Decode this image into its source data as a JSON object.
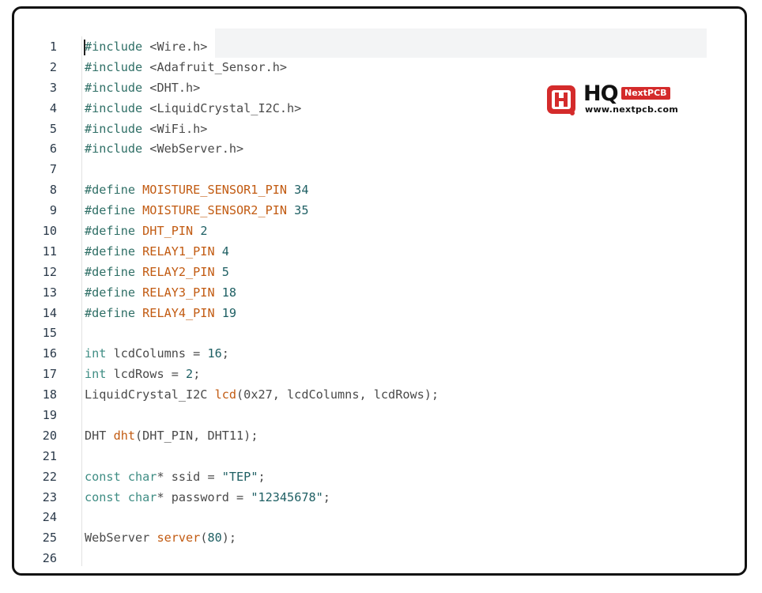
{
  "logo": {
    "brand_letters": "HQ",
    "badge": "NextPCB",
    "url": "www.nextpcb.com",
    "brand_color": "#d42b2b",
    "icon": "hq-logo-icon"
  },
  "editor": {
    "lines": [
      {
        "n": "1",
        "tokens": [
          {
            "t": "#include",
            "c": "kw"
          },
          {
            "t": " <Wire.h>",
            "c": "plain"
          }
        ]
      },
      {
        "n": "2",
        "tokens": [
          {
            "t": "#include",
            "c": "kw"
          },
          {
            "t": " <Adafruit_Sensor.h>",
            "c": "plain"
          }
        ]
      },
      {
        "n": "3",
        "tokens": [
          {
            "t": "#include",
            "c": "kw"
          },
          {
            "t": " <DHT.h>",
            "c": "plain"
          }
        ]
      },
      {
        "n": "4",
        "tokens": [
          {
            "t": "#include",
            "c": "kw"
          },
          {
            "t": " <LiquidCrystal_I2C.h>",
            "c": "plain"
          }
        ]
      },
      {
        "n": "5",
        "tokens": [
          {
            "t": "#include",
            "c": "kw"
          },
          {
            "t": " <WiFi.h>",
            "c": "plain"
          }
        ]
      },
      {
        "n": "6",
        "tokens": [
          {
            "t": "#include",
            "c": "kw"
          },
          {
            "t": " <WebServer.h>",
            "c": "plain"
          }
        ]
      },
      {
        "n": "7",
        "tokens": []
      },
      {
        "n": "8",
        "tokens": [
          {
            "t": "#define ",
            "c": "kw"
          },
          {
            "t": "MOISTURE_SENSOR1_PIN",
            "c": "mac"
          },
          {
            "t": " 34",
            "c": "num"
          }
        ]
      },
      {
        "n": "9",
        "tokens": [
          {
            "t": "#define ",
            "c": "kw"
          },
          {
            "t": "MOISTURE_SENSOR2_PIN",
            "c": "mac"
          },
          {
            "t": " 35",
            "c": "num"
          }
        ]
      },
      {
        "n": "10",
        "tokens": [
          {
            "t": "#define ",
            "c": "kw"
          },
          {
            "t": "DHT_PIN",
            "c": "mac"
          },
          {
            "t": " 2",
            "c": "num"
          }
        ]
      },
      {
        "n": "11",
        "tokens": [
          {
            "t": "#define ",
            "c": "kw"
          },
          {
            "t": "RELAY1_PIN",
            "c": "mac"
          },
          {
            "t": " 4",
            "c": "num"
          }
        ]
      },
      {
        "n": "12",
        "tokens": [
          {
            "t": "#define ",
            "c": "kw"
          },
          {
            "t": "RELAY2_PIN",
            "c": "mac"
          },
          {
            "t": " 5",
            "c": "num"
          }
        ]
      },
      {
        "n": "13",
        "tokens": [
          {
            "t": "#define ",
            "c": "kw"
          },
          {
            "t": "RELAY3_PIN",
            "c": "mac"
          },
          {
            "t": " 18",
            "c": "num"
          }
        ]
      },
      {
        "n": "14",
        "tokens": [
          {
            "t": "#define ",
            "c": "kw"
          },
          {
            "t": "RELAY4_PIN",
            "c": "mac"
          },
          {
            "t": " 19",
            "c": "num"
          }
        ]
      },
      {
        "n": "15",
        "tokens": []
      },
      {
        "n": "16",
        "tokens": [
          {
            "t": "int",
            "c": "kw2"
          },
          {
            "t": " lcdColumns = ",
            "c": "plain"
          },
          {
            "t": "16",
            "c": "num"
          },
          {
            "t": ";",
            "c": "plain"
          }
        ]
      },
      {
        "n": "17",
        "tokens": [
          {
            "t": "int",
            "c": "kw2"
          },
          {
            "t": " lcdRows = ",
            "c": "plain"
          },
          {
            "t": "2",
            "c": "num"
          },
          {
            "t": ";",
            "c": "plain"
          }
        ]
      },
      {
        "n": "18",
        "tokens": [
          {
            "t": "LiquidCrystal_I2C ",
            "c": "plain"
          },
          {
            "t": "lcd",
            "c": "fn"
          },
          {
            "t": "(0x27, lcdColumns, lcdRows);",
            "c": "plain"
          }
        ]
      },
      {
        "n": "19",
        "tokens": []
      },
      {
        "n": "20",
        "tokens": [
          {
            "t": "DHT ",
            "c": "plain"
          },
          {
            "t": "dht",
            "c": "fn"
          },
          {
            "t": "(DHT_PIN, DHT11);",
            "c": "plain"
          }
        ]
      },
      {
        "n": "21",
        "tokens": []
      },
      {
        "n": "22",
        "tokens": [
          {
            "t": "const",
            "c": "kw2"
          },
          {
            "t": " ",
            "c": "plain"
          },
          {
            "t": "char",
            "c": "kw2"
          },
          {
            "t": "* ssid = ",
            "c": "plain"
          },
          {
            "t": "\"TEP\"",
            "c": "str"
          },
          {
            "t": ";",
            "c": "plain"
          }
        ]
      },
      {
        "n": "23",
        "tokens": [
          {
            "t": "const",
            "c": "kw2"
          },
          {
            "t": " ",
            "c": "plain"
          },
          {
            "t": "char",
            "c": "kw2"
          },
          {
            "t": "* password = ",
            "c": "plain"
          },
          {
            "t": "\"12345678\"",
            "c": "str"
          },
          {
            "t": ";",
            "c": "plain"
          }
        ]
      },
      {
        "n": "24",
        "tokens": []
      },
      {
        "n": "25",
        "tokens": [
          {
            "t": "WebServer ",
            "c": "plain"
          },
          {
            "t": "server",
            "c": "fn"
          },
          {
            "t": "(",
            "c": "plain"
          },
          {
            "t": "80",
            "c": "num"
          },
          {
            "t": ");",
            "c": "plain"
          }
        ]
      },
      {
        "n": "26",
        "tokens": []
      }
    ]
  }
}
